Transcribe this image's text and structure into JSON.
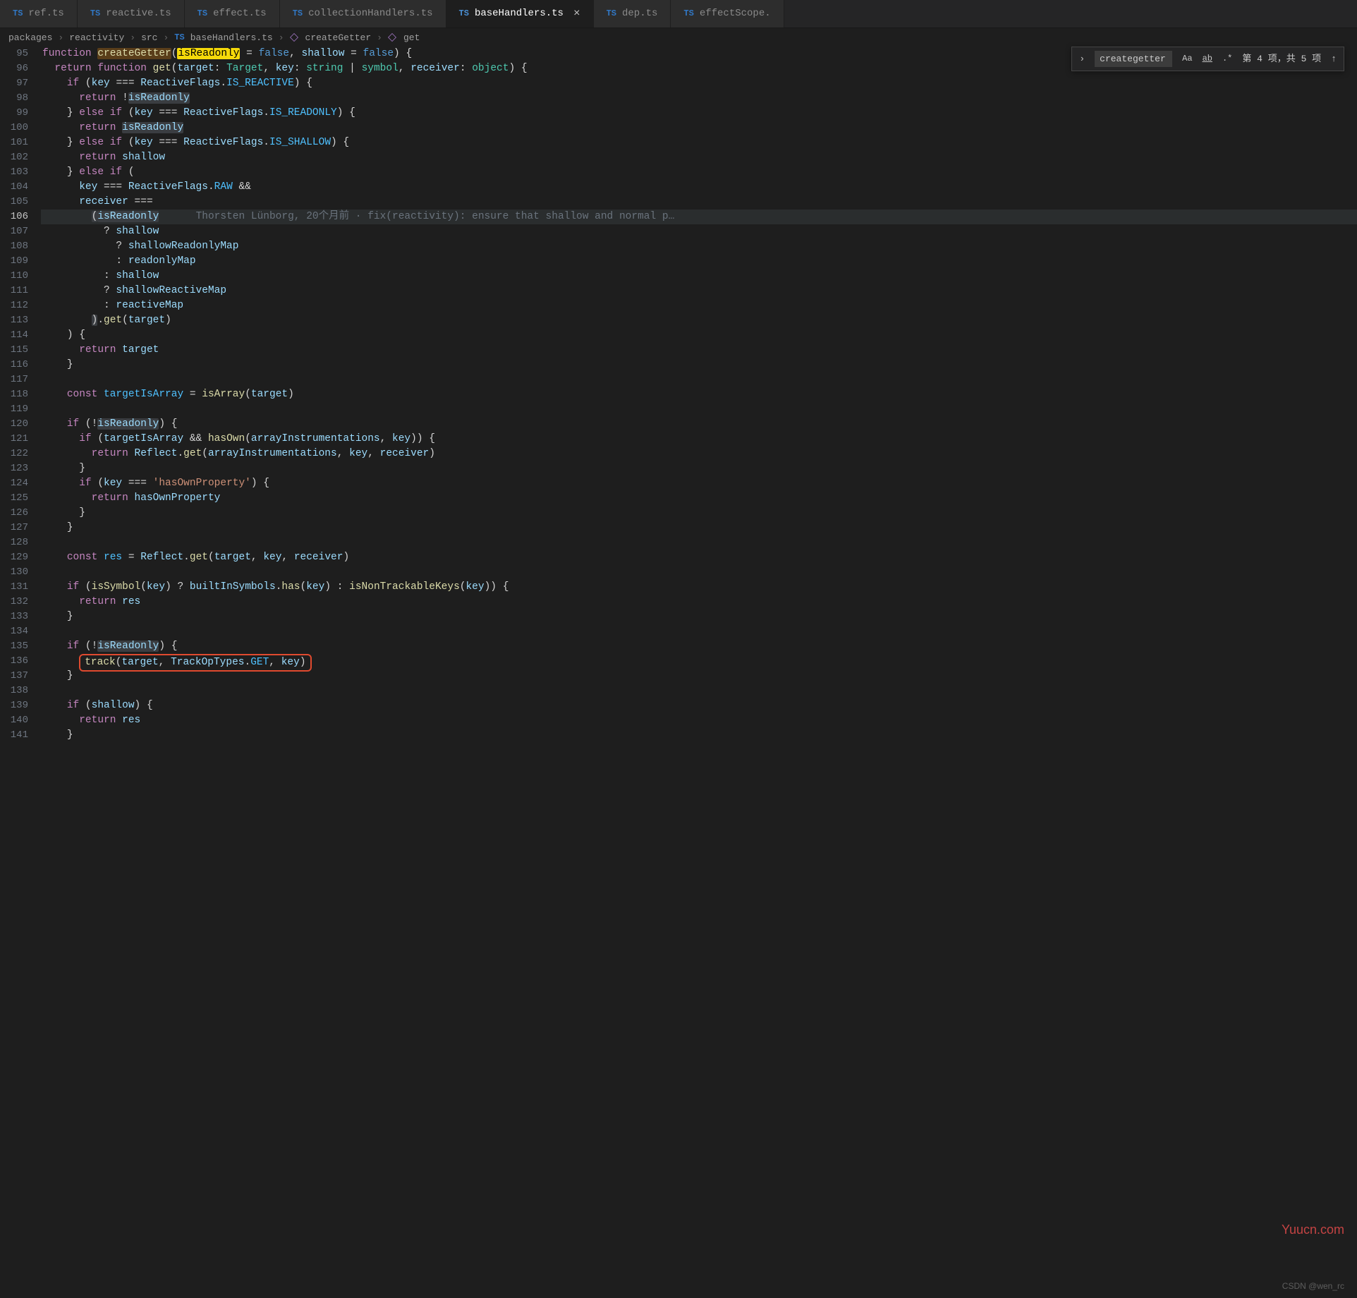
{
  "tabs": [
    {
      "label": "ref.ts"
    },
    {
      "label": "reactive.ts"
    },
    {
      "label": "effect.ts"
    },
    {
      "label": "collectionHandlers.ts"
    },
    {
      "label": "baseHandlers.ts",
      "active": true
    },
    {
      "label": "dep.ts"
    },
    {
      "label": "effectScope."
    }
  ],
  "ts_badge": "TS",
  "close_glyph": "×",
  "breadcrumbs": {
    "items": [
      "packages",
      "reactivity",
      "src"
    ],
    "file": "baseHandlers.ts",
    "symbol1": "createGetter",
    "symbol2": "get",
    "sep": "›"
  },
  "search": {
    "toggle": "›",
    "value": "creategetter",
    "opt_case": "Aa",
    "opt_word": "ab",
    "opt_regex": ".*",
    "status": "第 4 项，共 5 项",
    "up": "↑",
    "down": "↓"
  },
  "blame": "Thorsten Lünborg, 20个月前 · fix(reactivity): ensure that shallow and normal p…",
  "watermark1": "Yuucn.com",
  "watermark2": "CSDN @wen_rc",
  "lines": [
    {
      "n": 95,
      "html": "<span class=\"kw\">function</span> <span class=\"fn hl-search\">createGetter</span><span class=\"punc\">(</span><span class=\"param hl-yellow\">isReadonly</span> <span class=\"punc\">=</span> <span class=\"const-val\">false</span><span class=\"punc\">,</span> <span class=\"param\">shallow</span> <span class=\"punc\">=</span> <span class=\"const-val\">false</span><span class=\"punc\">) {</span>"
    },
    {
      "n": 96,
      "html": "  <span class=\"kw\">return</span> <span class=\"kw\">function</span> <span class=\"fn\">get</span><span class=\"punc\">(</span><span class=\"param\">target</span><span class=\"punc\">:</span> <span class=\"type\">Target</span><span class=\"punc\">,</span> <span class=\"param\">key</span><span class=\"punc\">:</span> <span class=\"type\">string</span> <span class=\"punc\">|</span> <span class=\"type\">symbol</span><span class=\"punc\">,</span> <span class=\"param\">receiver</span><span class=\"punc\">:</span> <span class=\"type\">object</span><span class=\"punc\">) {</span>"
    },
    {
      "n": 97,
      "html": "    <span class=\"kw\">if</span> <span class=\"punc\">(</span><span class=\"var\">key</span> <span class=\"punc\">===</span> <span class=\"var\">ReactiveFlags</span><span class=\"punc\">.</span><span class=\"prop\">IS_REACTIVE</span><span class=\"punc\">) {</span>"
    },
    {
      "n": 98,
      "html": "      <span class=\"kw\">return</span> <span class=\"punc\">!</span><span class=\"var hl-occ\">isReadonly</span>"
    },
    {
      "n": 99,
      "html": "    <span class=\"punc\">}</span> <span class=\"kw\">else</span> <span class=\"kw\">if</span> <span class=\"punc\">(</span><span class=\"var\">key</span> <span class=\"punc\">===</span> <span class=\"var\">ReactiveFlags</span><span class=\"punc\">.</span><span class=\"prop\">IS_READONLY</span><span class=\"punc\">) {</span>"
    },
    {
      "n": 100,
      "html": "      <span class=\"kw\">return</span> <span class=\"var hl-occ\">isReadonly</span>"
    },
    {
      "n": 101,
      "html": "    <span class=\"punc\">}</span> <span class=\"kw\">else</span> <span class=\"kw\">if</span> <span class=\"punc\">(</span><span class=\"var\">key</span> <span class=\"punc\">===</span> <span class=\"var\">ReactiveFlags</span><span class=\"punc\">.</span><span class=\"prop\">IS_SHALLOW</span><span class=\"punc\">) {</span>"
    },
    {
      "n": 102,
      "html": "      <span class=\"kw\">return</span> <span class=\"var\">shallow</span>"
    },
    {
      "n": 103,
      "html": "    <span class=\"punc\">}</span> <span class=\"kw\">else</span> <span class=\"kw\">if</span> <span class=\"punc\">(</span>"
    },
    {
      "n": 104,
      "html": "      <span class=\"var\">key</span> <span class=\"punc\">===</span> <span class=\"var\">ReactiveFlags</span><span class=\"punc\">.</span><span class=\"prop\">RAW</span> <span class=\"punc\">&amp;&amp;</span>"
    },
    {
      "n": 105,
      "html": "      <span class=\"var\">receiver</span> <span class=\"punc\">===</span>"
    },
    {
      "n": 106,
      "active": true,
      "hl": true,
      "html": "        <span class=\"punc hl-occ\">(</span><span class=\"var hl-occ\">isReadonly</span>      <span class=\"comment\" data-bind=\"blame\"></span>"
    },
    {
      "n": 107,
      "html": "          <span class=\"punc\">?</span> <span class=\"var\">shallow</span>"
    },
    {
      "n": 108,
      "html": "            <span class=\"punc\">?</span> <span class=\"var\">shallowReadonlyMap</span>"
    },
    {
      "n": 109,
      "html": "            <span class=\"punc\">:</span> <span class=\"var\">readonlyMap</span>"
    },
    {
      "n": 110,
      "html": "          <span class=\"punc\">:</span> <span class=\"var\">shallow</span>"
    },
    {
      "n": 111,
      "html": "          <span class=\"punc\">?</span> <span class=\"var\">shallowReactiveMap</span>"
    },
    {
      "n": 112,
      "html": "          <span class=\"punc\">:</span> <span class=\"var\">reactiveMap</span>"
    },
    {
      "n": 113,
      "html": "        <span class=\"punc hl-occ\">)</span><span class=\"punc\">.</span><span class=\"fn\">get</span><span class=\"punc\">(</span><span class=\"var\">target</span><span class=\"punc\">)</span>"
    },
    {
      "n": 114,
      "html": "    <span class=\"punc\">) {</span>"
    },
    {
      "n": 115,
      "html": "      <span class=\"kw\">return</span> <span class=\"var\">target</span>"
    },
    {
      "n": 116,
      "html": "    <span class=\"punc\">}</span>"
    },
    {
      "n": 117,
      "html": ""
    },
    {
      "n": 118,
      "html": "    <span class=\"kw\">const</span> <span class=\"prop\">targetIsArray</span> <span class=\"punc\">=</span> <span class=\"fn\">isArray</span><span class=\"punc\">(</span><span class=\"var\">target</span><span class=\"punc\">)</span>"
    },
    {
      "n": 119,
      "html": ""
    },
    {
      "n": 120,
      "html": "    <span class=\"kw\">if</span> <span class=\"punc\">(!</span><span class=\"var hl-occ\">isReadonly</span><span class=\"punc\">) {</span>"
    },
    {
      "n": 121,
      "html": "      <span class=\"kw\">if</span> <span class=\"punc\">(</span><span class=\"var\">targetIsArray</span> <span class=\"punc\">&amp;&amp;</span> <span class=\"fn\">hasOwn</span><span class=\"punc\">(</span><span class=\"var\">arrayInstrumentations</span><span class=\"punc\">,</span> <span class=\"var\">key</span><span class=\"punc\">)) {</span>"
    },
    {
      "n": 122,
      "html": "        <span class=\"kw\">return</span> <span class=\"var\">Reflect</span><span class=\"punc\">.</span><span class=\"fn\">get</span><span class=\"punc\">(</span><span class=\"var\">arrayInstrumentations</span><span class=\"punc\">,</span> <span class=\"var\">key</span><span class=\"punc\">,</span> <span class=\"var\">receiver</span><span class=\"punc\">)</span>"
    },
    {
      "n": 123,
      "html": "      <span class=\"punc\">}</span>"
    },
    {
      "n": 124,
      "html": "      <span class=\"kw\">if</span> <span class=\"punc\">(</span><span class=\"var\">key</span> <span class=\"punc\">===</span> <span class=\"str\">'hasOwnProperty'</span><span class=\"punc\">) {</span>"
    },
    {
      "n": 125,
      "html": "        <span class=\"kw\">return</span> <span class=\"var\">hasOwnProperty</span>"
    },
    {
      "n": 126,
      "html": "      <span class=\"punc\">}</span>"
    },
    {
      "n": 127,
      "html": "    <span class=\"punc\">}</span>"
    },
    {
      "n": 128,
      "html": ""
    },
    {
      "n": 129,
      "html": "    <span class=\"kw\">const</span> <span class=\"prop\">res</span> <span class=\"punc\">=</span> <span class=\"var\">Reflect</span><span class=\"punc\">.</span><span class=\"fn\">get</span><span class=\"punc\">(</span><span class=\"var\">target</span><span class=\"punc\">,</span> <span class=\"var\">key</span><span class=\"punc\">,</span> <span class=\"var\">receiver</span><span class=\"punc\">)</span>"
    },
    {
      "n": 130,
      "html": ""
    },
    {
      "n": 131,
      "html": "    <span class=\"kw\">if</span> <span class=\"punc\">(</span><span class=\"fn\">isSymbol</span><span class=\"punc\">(</span><span class=\"var\">key</span><span class=\"punc\">)</span> <span class=\"punc\">?</span> <span class=\"var\">builtInSymbols</span><span class=\"punc\">.</span><span class=\"fn\">has</span><span class=\"punc\">(</span><span class=\"var\">key</span><span class=\"punc\">)</span> <span class=\"punc\">:</span> <span class=\"fn\">isNonTrackableKeys</span><span class=\"punc\">(</span><span class=\"var\">key</span><span class=\"punc\">)) {</span>"
    },
    {
      "n": 132,
      "html": "      <span class=\"kw\">return</span> <span class=\"var\">res</span>"
    },
    {
      "n": 133,
      "html": "    <span class=\"punc\">}</span>"
    },
    {
      "n": 134,
      "html": ""
    },
    {
      "n": 135,
      "html": "    <span class=\"kw\">if</span> <span class=\"punc\">(!</span><span class=\"var hl-occ\">isReadonly</span><span class=\"punc\">) {</span>"
    },
    {
      "n": 136,
      "redbox": true,
      "html": "<span class=\"fn\">track</span><span class=\"punc\">(</span><span class=\"var\">target</span><span class=\"punc\">,</span> <span class=\"var\">TrackOpTypes</span><span class=\"punc\">.</span><span class=\"prop\">GET</span><span class=\"punc\">,</span> <span class=\"var\">key</span><span class=\"punc\">)</span>"
    },
    {
      "n": 137,
      "html": "    <span class=\"punc\">}</span>"
    },
    {
      "n": 138,
      "html": ""
    },
    {
      "n": 139,
      "html": "    <span class=\"kw\">if</span> <span class=\"punc\">(</span><span class=\"var\">shallow</span><span class=\"punc\">) {</span>"
    },
    {
      "n": 140,
      "html": "      <span class=\"kw\">return</span> <span class=\"var\">res</span>"
    },
    {
      "n": 141,
      "html": "    <span class=\"punc\">}</span>"
    }
  ]
}
